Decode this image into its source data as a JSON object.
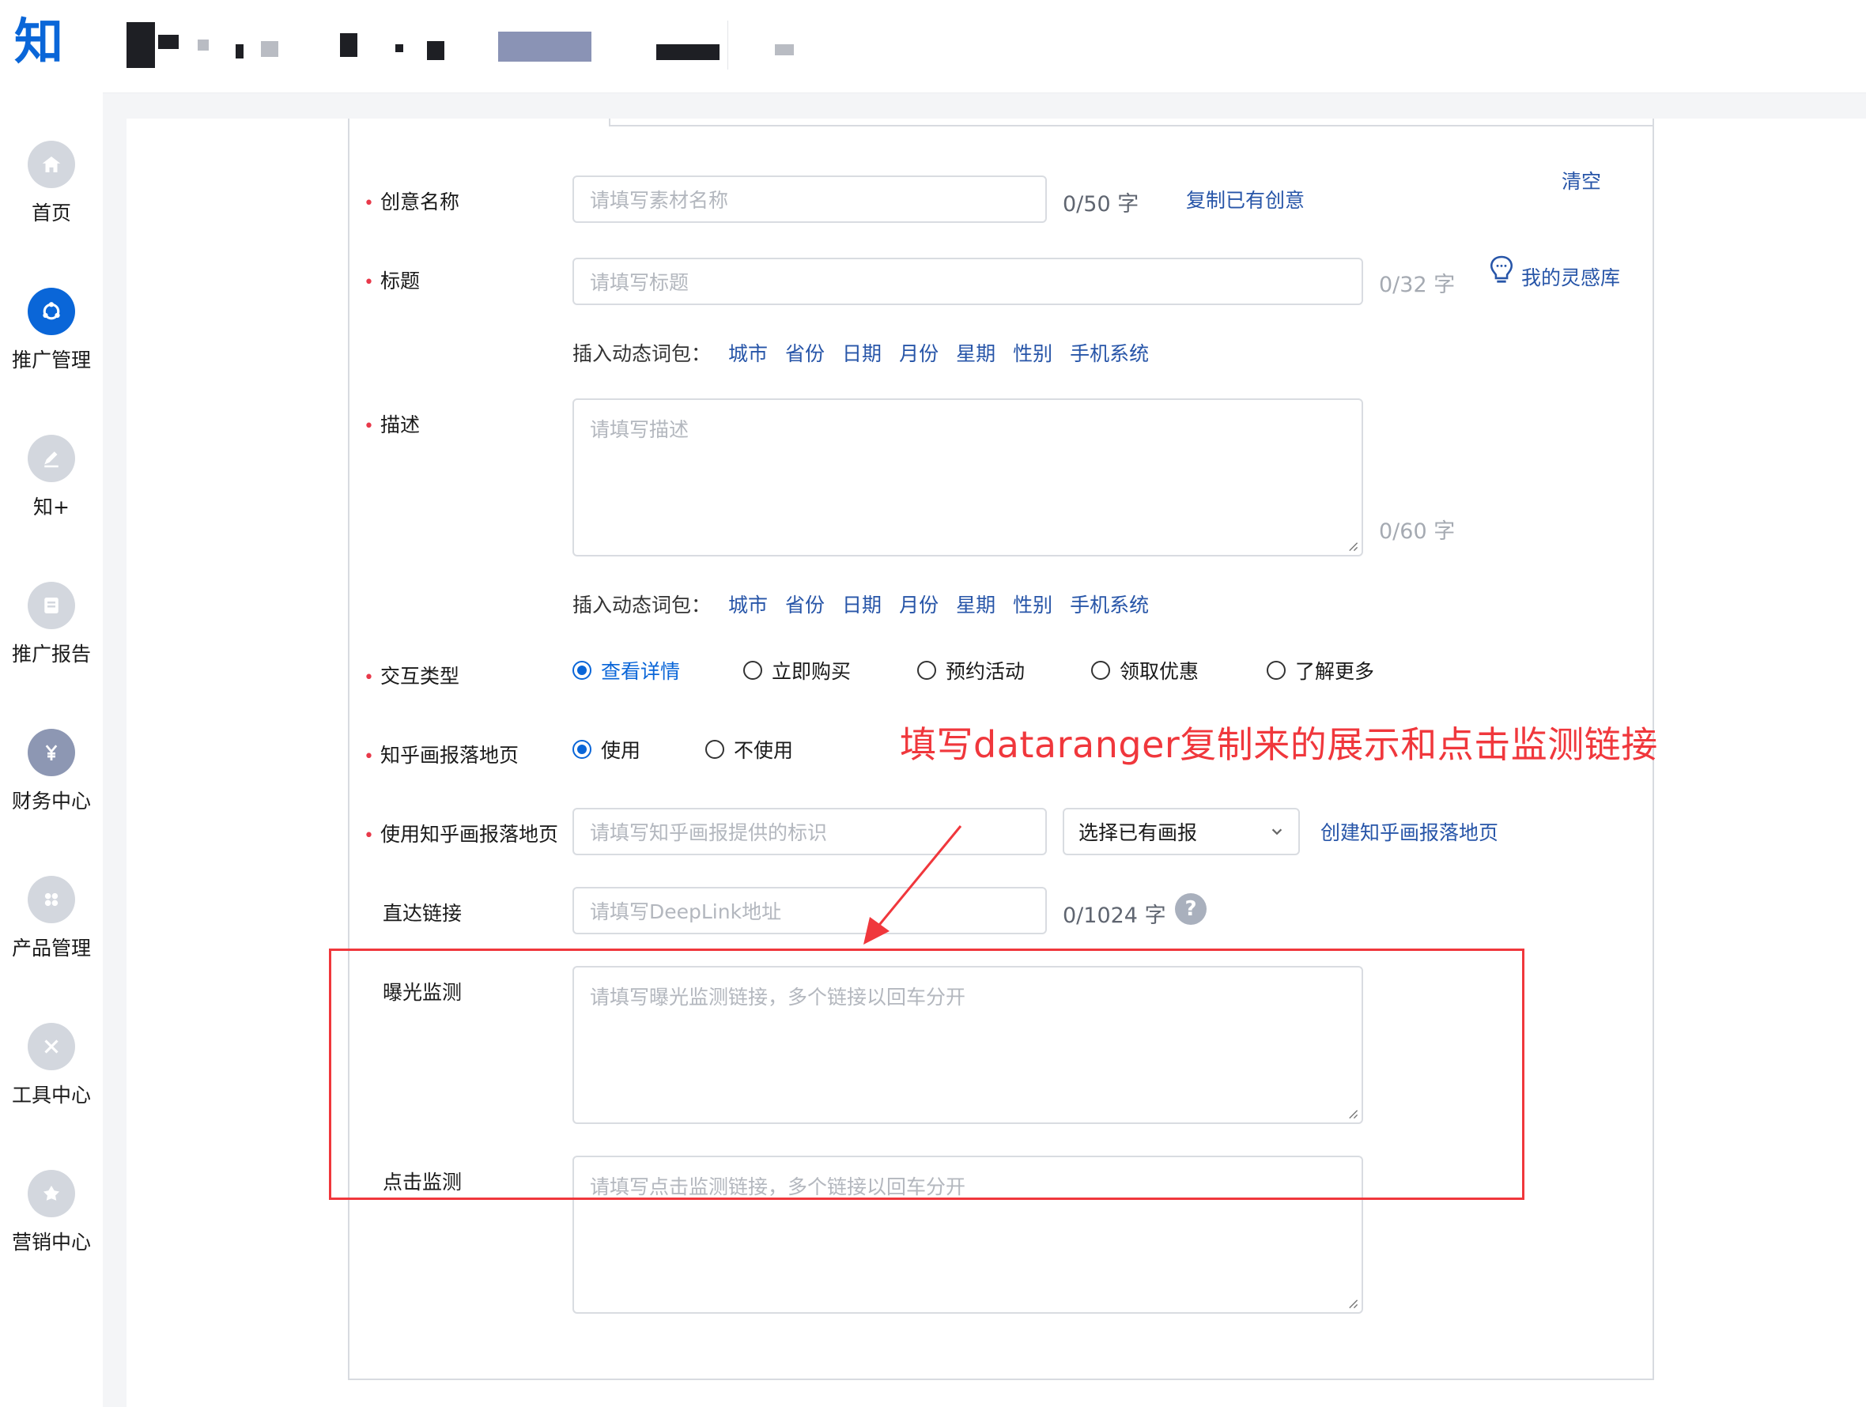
{
  "app": {
    "logo_char": "知"
  },
  "sidebar": {
    "items": [
      {
        "label": "首页",
        "icon": "home-icon",
        "active": false
      },
      {
        "label": "推广管理",
        "icon": "promotion-icon",
        "active": true
      },
      {
        "label": "知+",
        "icon": "pen-icon",
        "active": false
      },
      {
        "label": "推广报告",
        "icon": "report-icon",
        "active": false
      },
      {
        "label": "财务中心",
        "icon": "yuan-icon",
        "active": false
      },
      {
        "label": "产品管理",
        "icon": "grid-icon",
        "active": false
      },
      {
        "label": "工具中心",
        "icon": "tools-icon",
        "active": false
      },
      {
        "label": "营销中心",
        "icon": "marketing-icon",
        "active": false
      }
    ]
  },
  "form": {
    "clear_link": "清空",
    "creative_name": {
      "label": "创意名称",
      "placeholder": "请填写素材名称",
      "counter": "0/50 字",
      "copy_link": "复制已有创意"
    },
    "title": {
      "label": "标题",
      "placeholder": "请填写标题",
      "counter": "0/32 字",
      "inspiration_link": "我的灵感库"
    },
    "insert_words": {
      "label": "插入动态词包：",
      "tags": [
        "城市",
        "省份",
        "日期",
        "月份",
        "星期",
        "性别",
        "手机系统"
      ]
    },
    "description": {
      "label": "描述",
      "placeholder": "请填写描述",
      "counter": "0/60 字"
    },
    "interaction_type": {
      "label": "交互类型",
      "options": [
        "查看详情",
        "立即购买",
        "预约活动",
        "领取优惠",
        "了解更多"
      ],
      "selected": "查看详情"
    },
    "landing_page": {
      "label": "知乎画报落地页",
      "options": [
        "使用",
        "不使用"
      ],
      "selected": "使用"
    },
    "use_landing_page": {
      "label": "使用知乎画报落地页",
      "placeholder": "请填写知乎画报提供的标识",
      "select_value": "选择已有画报",
      "create_link": "创建知乎画报落地页"
    },
    "deeplink": {
      "label": "直达链接",
      "placeholder": "请填写DeepLink地址",
      "counter": "0/1024 字",
      "help": "?"
    },
    "impression_monitor": {
      "label": "曝光监测",
      "placeholder": "请填写曝光监测链接，多个链接以回车分开"
    },
    "click_monitor": {
      "label": "点击监测",
      "placeholder": "请填写点击监测链接，多个链接以回车分开"
    }
  },
  "annotation": {
    "text": "填写dataranger复制来的展示和点击监测链接",
    "color": "#f0373c"
  },
  "colors": {
    "brand": "#0a66d8",
    "link": "#2755a8",
    "required": "#e8394a"
  }
}
